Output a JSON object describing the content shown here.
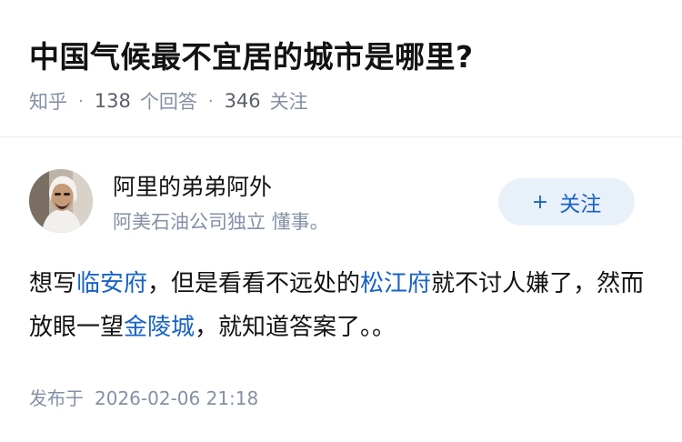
{
  "question": {
    "title": "中国气候最不宜居的城市是哪里?",
    "source": "知乎",
    "answer_count": "138",
    "answer_label": "个回答",
    "follower_count": "346",
    "follower_label": "关注",
    "separator": "·"
  },
  "author": {
    "name": "阿里的弟弟阿外",
    "bio": "阿美石油公司独立 懂事。",
    "follow_label": "关注",
    "follow_icon": "+"
  },
  "answer": {
    "part1": "想写",
    "link1": "临安府",
    "part2": "，但是看看不远处的",
    "link2": "松江府",
    "part3": "就不讨人嫌了，然而放眼一望",
    "link3": "金陵城",
    "part4": "，就知道答案了。。"
  },
  "footer": {
    "published_label": "发布于",
    "published_time": "2026-02-06 21:18"
  },
  "colors": {
    "link": "#1963c4",
    "meta": "#8590a6",
    "follow_bg": "#e8f0fa"
  }
}
